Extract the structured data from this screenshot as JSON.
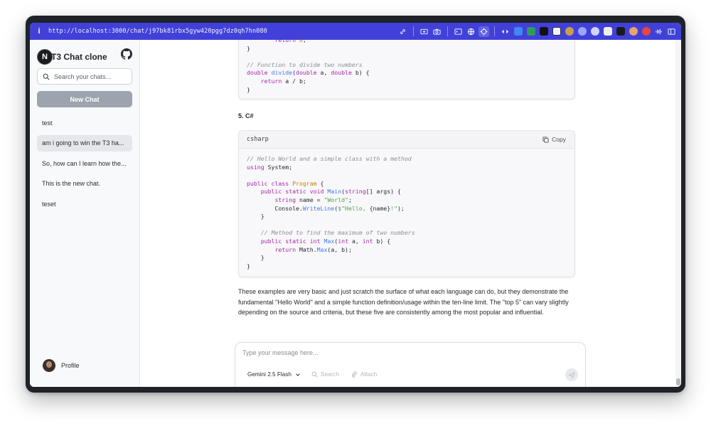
{
  "browser": {
    "url": "http://localhost:3000/chat/j97bk81rbx5gyw420pgg7dz0qh7hn080",
    "info_glyph": "i"
  },
  "sidebar": {
    "logo_letter": "N",
    "title": "T3 Chat clone",
    "search_placeholder": "Search your chats...",
    "new_chat_label": "New Chat",
    "chats": [
      {
        "label": "test"
      },
      {
        "label": "am i going to win the T3 ha..."
      },
      {
        "label": "So, how can I learn how the..."
      },
      {
        "label": "This is the new chat."
      },
      {
        "label": "teset"
      }
    ],
    "profile_label": "Profile"
  },
  "main": {
    "section_heading": "5. C#",
    "csharp_block": {
      "language": "csharp",
      "copy_label": "Copy"
    },
    "paragraph": "These examples are very basic and just scratch the surface of what each language can do, but they demonstrate the fundamental \"Hello World\" and a simple function definition/usage within the ten-line limit. The \"top 5\" can vary slightly depending on the source and criteria, but these five are consistently among the most popular and influential."
  },
  "composer": {
    "placeholder": "Type your message here...",
    "model": "Gemini 2.5 Flash",
    "search_label": "Search",
    "attach_label": "Attach"
  },
  "colors": {
    "url_bar": "#4141d9",
    "new_chat_button": "#9ea4ad",
    "sidebar_bg": "#f8f9fb"
  }
}
